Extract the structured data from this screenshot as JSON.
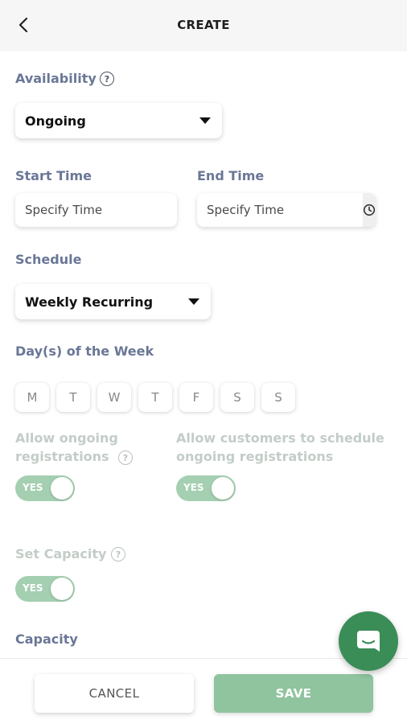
{
  "header": {
    "title": "CREATE"
  },
  "availability": {
    "label": "Availability",
    "value": "Ongoing"
  },
  "start_time": {
    "label": "Start Time",
    "placeholder": "Specify Time"
  },
  "end_time": {
    "label": "End Time",
    "placeholder": "Specify Time"
  },
  "schedule": {
    "label": "Schedule",
    "value": "Weekly Recurring"
  },
  "days_of_week": {
    "label": "Day(s) of the Week",
    "days": [
      "M",
      "T",
      "W",
      "T",
      "F",
      "S",
      "S"
    ]
  },
  "allow_ongoing": {
    "label_line1": "Allow ongoing",
    "label_line2": "registrations",
    "toggle": "YES"
  },
  "allow_customers": {
    "label_line1": "Allow customers to schedule",
    "label_line2": "ongoing registrations",
    "toggle": "YES"
  },
  "set_capacity": {
    "label": "Set Capacity",
    "toggle": "YES"
  },
  "capacity": {
    "label": "Capacity"
  },
  "footer": {
    "cancel_label": "CANCEL",
    "save_label": "SAVE"
  },
  "colors": {
    "accent": "#3a8d57",
    "toggle_on": "#a4cfb1",
    "save_button": "#8fc49e",
    "label": "#6a7796"
  },
  "icons": {
    "back": "chevron-left-icon",
    "help": "question-circle-icon",
    "clock": "clock-icon",
    "caret": "caret-down-icon",
    "chat": "chat-bubble-icon"
  }
}
